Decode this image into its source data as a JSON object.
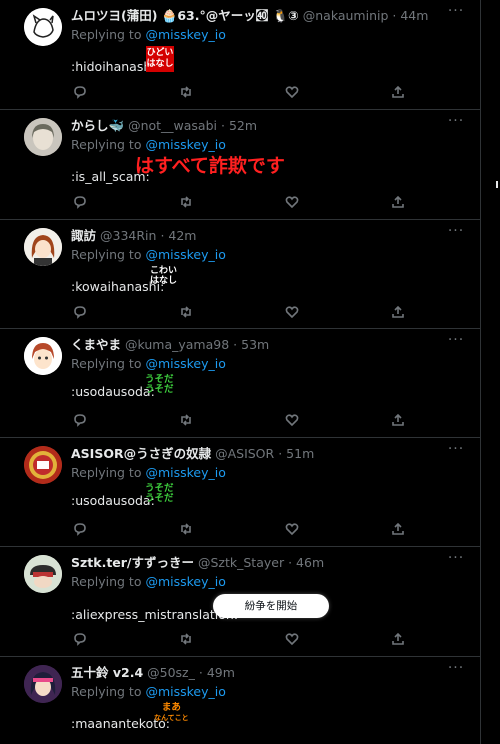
{
  "ui": {
    "replying_to_label": "Replying to",
    "replying_to_handle": "@misskey_io",
    "tooltip": "紛争を開始"
  },
  "colors": {
    "background": "#000000",
    "link": "#1d9bf0",
    "muted": "#71767b"
  },
  "tweets": [
    {
      "name": "ムロツヨ(蒲田) 🧁63.°@ヤーッ㉋ 🐧③",
      "handle": "@nakauminip",
      "time": "44m",
      "body": ":hidoihanashi:",
      "emoji": [
        "ひどい",
        "はなし"
      ]
    },
    {
      "name": "からし🐳",
      "handle": "@not__wasabi",
      "time": "52m",
      "body": ":is_all_scam:",
      "emoji": [
        "はすべて詐欺です"
      ]
    },
    {
      "name": "諏訪",
      "handle": "@334Rin",
      "time": "42m",
      "body": ":kowaihanashi:",
      "emoji": [
        "こわい",
        "はなし"
      ]
    },
    {
      "name": "くまやま",
      "handle": "@kuma_yama98",
      "time": "53m",
      "body": ":usodausoda:",
      "emoji": [
        "うそだ",
        "うそだ"
      ]
    },
    {
      "name": "ASISOR@うさぎの奴隷",
      "handle": "@ASISOR",
      "time": "51m",
      "body": ":usodausoda:",
      "emoji": [
        "うそだ",
        "うそだ"
      ]
    },
    {
      "name": "Sztk.ter/すずっきー",
      "handle": "@Sztk_Stayer",
      "time": "46m",
      "body": ":aliexpress_mistranslation:",
      "emoji": []
    },
    {
      "name": "五十鈴 v2.4",
      "handle": "@50sz_",
      "time": "49m",
      "body": ":maanantekoto:",
      "emoji": [
        "まあ",
        "なんてこと"
      ]
    }
  ],
  "icons": [
    "more-icon",
    "reply-icon",
    "retweet-icon",
    "like-icon",
    "share-icon"
  ]
}
